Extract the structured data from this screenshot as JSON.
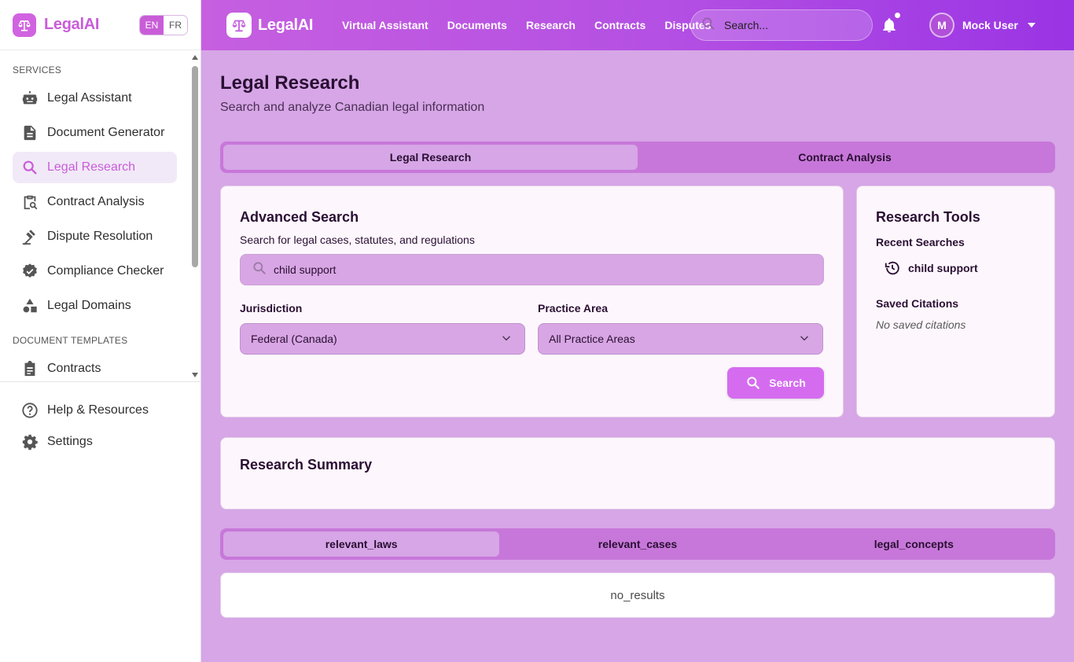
{
  "sidebar": {
    "brand": "LegalAI",
    "lang": {
      "en": "EN",
      "fr": "FR"
    },
    "services_heading": "SERVICES",
    "items": [
      {
        "label": "Legal Assistant",
        "icon": "robot-icon"
      },
      {
        "label": "Document Generator",
        "icon": "document-icon"
      },
      {
        "label": "Legal Research",
        "icon": "search-icon",
        "active": true
      },
      {
        "label": "Contract Analysis",
        "icon": "clipboard-search-icon"
      },
      {
        "label": "Dispute Resolution",
        "icon": "gavel-icon"
      },
      {
        "label": "Compliance Checker",
        "icon": "verified-badge-icon"
      },
      {
        "label": "Legal Domains",
        "icon": "shapes-icon"
      }
    ],
    "templates_heading": "DOCUMENT TEMPLATES",
    "templates": [
      {
        "label": "Contracts",
        "icon": "assignment-icon"
      }
    ],
    "bottom": [
      {
        "label": "Help & Resources",
        "icon": "help-circle-icon"
      },
      {
        "label": "Settings",
        "icon": "gear-icon"
      }
    ]
  },
  "topbar": {
    "brand": "LegalAI",
    "nav": [
      "Virtual Assistant",
      "Documents",
      "Research",
      "Contracts",
      "Disputes"
    ],
    "search_placeholder": "Search...",
    "user": {
      "initial": "M",
      "name": "Mock User"
    }
  },
  "main": {
    "title": "Legal Research",
    "subtitle": "Search and analyze Canadian legal information",
    "tabs": [
      {
        "label": "Legal Research",
        "active": true
      },
      {
        "label": "Contract Analysis",
        "active": false
      }
    ],
    "advanced": {
      "title": "Advanced Search",
      "subtitle": "Search for legal cases, statutes, and regulations",
      "query": "child support",
      "jurisdiction_label": "Jurisdiction",
      "jurisdiction_value": "Federal (Canada)",
      "practice_label": "Practice Area",
      "practice_value": "All Practice Areas",
      "search_button": "Search"
    },
    "tools": {
      "title": "Research Tools",
      "recent_heading": "Recent Searches",
      "recent": [
        "child support"
      ],
      "saved_heading": "Saved Citations",
      "saved_empty": "No saved citations"
    },
    "summary": {
      "title": "Research Summary"
    },
    "result_tabs": [
      {
        "label": "relevant_laws",
        "active": true
      },
      {
        "label": "relevant_cases",
        "active": false
      },
      {
        "label": "legal_concepts",
        "active": false
      }
    ],
    "no_results": "no_results"
  },
  "colors": {
    "accent": "#c95dd8",
    "page_bg": "#d6a6e6",
    "tab_track": "#c777d9",
    "button": "#d56cf0"
  }
}
